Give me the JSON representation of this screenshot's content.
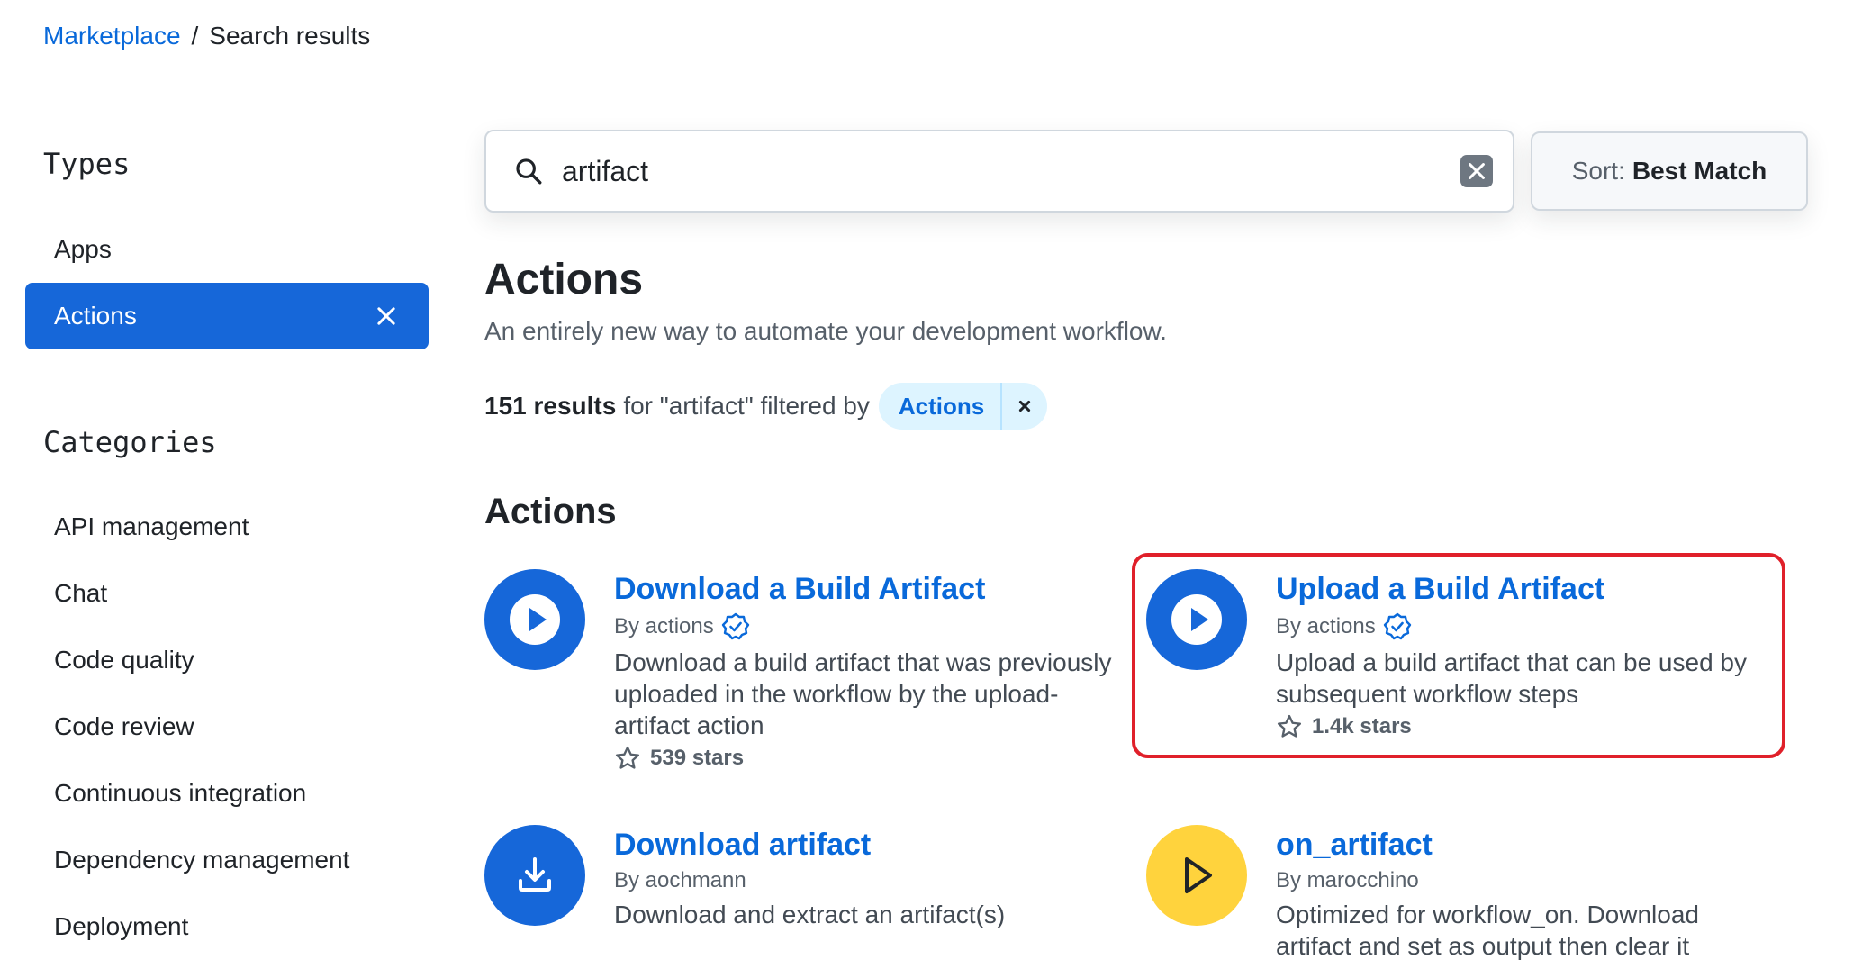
{
  "breadcrumb": {
    "link": "Marketplace",
    "separator": "/",
    "current": "Search results"
  },
  "sidebar": {
    "types_heading": "Types",
    "types": [
      {
        "label": "Apps",
        "active": false
      },
      {
        "label": "Actions",
        "active": true
      }
    ],
    "categories_heading": "Categories",
    "categories": [
      "API management",
      "Chat",
      "Code quality",
      "Code review",
      "Continuous integration",
      "Dependency management",
      "Deployment"
    ]
  },
  "search": {
    "value": "artifact"
  },
  "sort": {
    "label": "Sort:",
    "value": "Best Match"
  },
  "page": {
    "title": "Actions",
    "subtitle": "An entirely new way to automate your development workflow.",
    "results_count": "151 results",
    "results_text": "for \"artifact\" filtered by",
    "filter_chip": "Actions",
    "section_title": "Actions"
  },
  "results": [
    {
      "title": "Download a Build Artifact",
      "by": "By actions",
      "verified": true,
      "description": "Download a build artifact that was previously uploaded in the workflow by the upload-artifact action",
      "stars": "539 stars",
      "icon": "play-icon",
      "icon_color": "#1667d9"
    },
    {
      "title": "Upload a Build Artifact",
      "by": "By actions",
      "verified": true,
      "description": "Upload a build artifact that can be used by subsequent workflow steps",
      "stars": "1.4k stars",
      "icon": "play-icon",
      "icon_color": "#1667d9",
      "highlighted": true
    },
    {
      "title": "Download artifact",
      "by": "By aochmann",
      "verified": false,
      "description": "Download and extract an artifact(s)",
      "icon": "download-icon",
      "icon_color": "#1667d9"
    },
    {
      "title": "on_artifact",
      "by": "By marocchino",
      "verified": false,
      "description": "Optimized for workflow_on. Download artifact and set as output then clear it",
      "icon": "play-outline-icon",
      "icon_color": "#ffd33d"
    }
  ],
  "colors": {
    "accent": "#0969da",
    "active_bg": "#1667d9",
    "highlight_border": "#e0202a"
  }
}
